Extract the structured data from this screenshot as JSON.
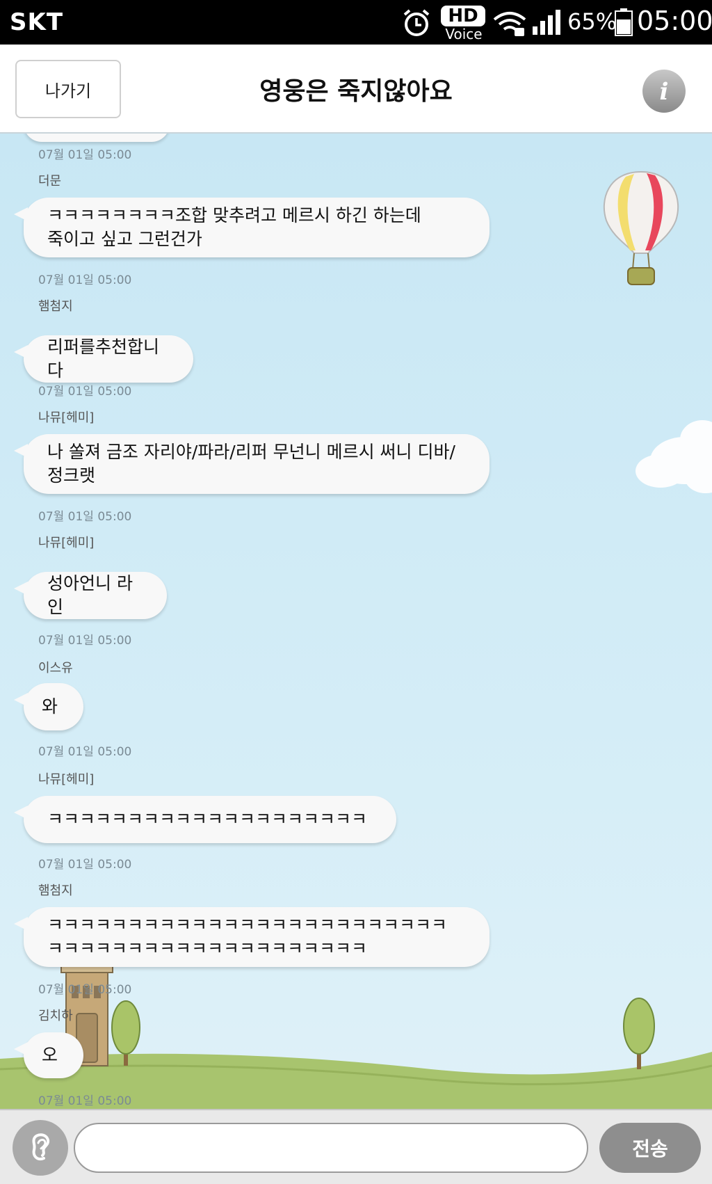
{
  "status_bar": {
    "carrier": "SKT",
    "hd_label": "HD",
    "voice_label": "Voice",
    "battery_percent": "65%",
    "time": "05:00",
    "icons": [
      "alarm-icon",
      "hd-voice-icon",
      "wifi-icon",
      "signal-icon",
      "battery-icon"
    ]
  },
  "header": {
    "exit_label": "나가기",
    "title": "영웅은 죽지않아요",
    "info_label": "i"
  },
  "messages": [
    {
      "timestamp": "07월 01일 05:00",
      "sender": "",
      "text": ""
    },
    {
      "timestamp": "07월 01일 05:00",
      "sender": "더문",
      "text": "ㅋㅋㅋㅋㅋㅋㅋㅋ조합 맞추려고 메르시 하긴 하는데\n죽이고 싶고 그런건가"
    },
    {
      "timestamp": "07월 01일 05:00",
      "sender": "햄첨지",
      "text": "리퍼를추천합니다"
    },
    {
      "timestamp": "07월 01일 05:00",
      "sender": "나뮤[헤미]",
      "text": "나 쏠져 금조 자리야/파라/리퍼 무넌니 메르시 써니 디바/\n정크랫"
    },
    {
      "timestamp": "07월 01일 05:00",
      "sender": "나뮤[헤미]",
      "text": "성아언니 라인"
    },
    {
      "timestamp": "07월 01일 05:00",
      "sender": "이스유",
      "text": "와"
    },
    {
      "timestamp": "07월 01일 05:00",
      "sender": "나뮤[헤미]",
      "text": "ㅋㅋㅋㅋㅋㅋㅋㅋㅋㅋㅋㅋㅋㅋㅋㅋㅋㅋㅋㅋ"
    },
    {
      "timestamp": "07월 01일 05:00",
      "sender": "햄첨지",
      "text": "ㅋㅋㅋㅋㅋㅋㅋㅋㅋㅋㅋㅋㅋㅋㅋㅋㅋㅋㅋㅋㅋㅋㅋㅋㅋ\nㅋㅋㅋㅋㅋㅋㅋㅋㅋㅋㅋㅋㅋㅋㅋㅋㅋㅋㅋㅋ"
    },
    {
      "timestamp": "07월 01일 05:00",
      "sender": "김치하",
      "text": "오"
    }
  ],
  "input": {
    "value": "",
    "placeholder": "",
    "send_label": "전송"
  },
  "colors": {
    "sky": "#cfeaf5",
    "bubble": "#f8f8f8",
    "send_button": "#8e8e8e",
    "grass": "#a8c46e"
  }
}
